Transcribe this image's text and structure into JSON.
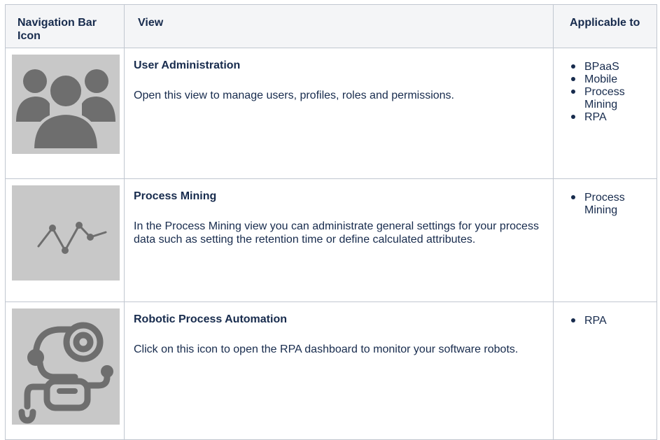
{
  "table": {
    "headers": {
      "icon": "Navigation Bar Icon",
      "view": "View",
      "applicable": "Applicable to"
    },
    "rows": [
      {
        "icon": "user-group-icon",
        "title": "User Administration",
        "description": "Open this view to manage users, profiles, roles and permissions.",
        "applicable": [
          "BPaaS",
          "Mobile",
          "Process Mining",
          "RPA"
        ]
      },
      {
        "icon": "process-mining-icon",
        "title": "Process Mining",
        "description": "In the Process Mining view you can administrate general settings for your process data such as setting the retention time or define calculated attributes.",
        "applicable": [
          "Process Mining"
        ]
      },
      {
        "icon": "robot-icon",
        "title": "Robotic Process Automation",
        "description": "Click on this icon to open the RPA dashboard to monitor your software robots.",
        "applicable": [
          "RPA"
        ]
      }
    ]
  },
  "colors": {
    "icon_background": "#c8c8c8",
    "icon_foreground": "#6e6e6e",
    "header_background": "#f4f5f7",
    "border": "#c1c7d0",
    "text": "#172b4d"
  }
}
